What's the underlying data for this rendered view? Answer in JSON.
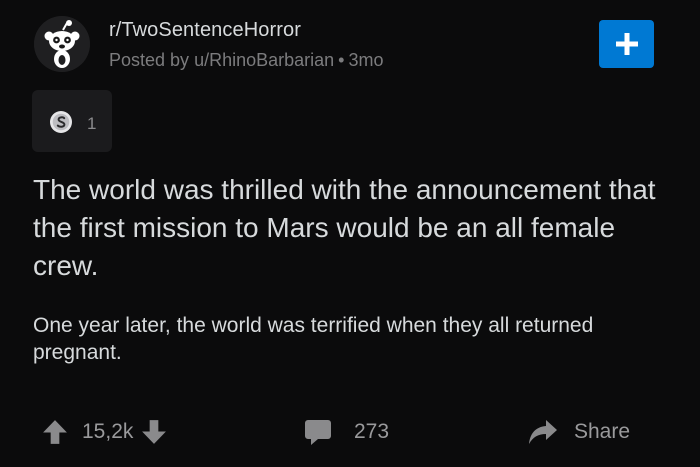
{
  "header": {
    "subreddit": "r/TwoSentenceHorror",
    "posted_by_prefix": "Posted by",
    "username": "u/RhinoBarbarian",
    "separator": "•",
    "age": "3mo",
    "join_icon": "plus-icon"
  },
  "awards": {
    "icon": "silver-award-icon",
    "count": "1"
  },
  "post": {
    "title": "The world was thrilled with the announcement that the first mission to Mars would be an all female crew.",
    "body": "One year later, the world was terrified when they all returned pregnant."
  },
  "actions": {
    "score": "15,2k",
    "comments": "273",
    "share_label": "Share"
  },
  "colors": {
    "background": "#0b0b0c",
    "accent": "#0079d3",
    "text": "#d7dadc",
    "muted": "#7c7c7e"
  }
}
